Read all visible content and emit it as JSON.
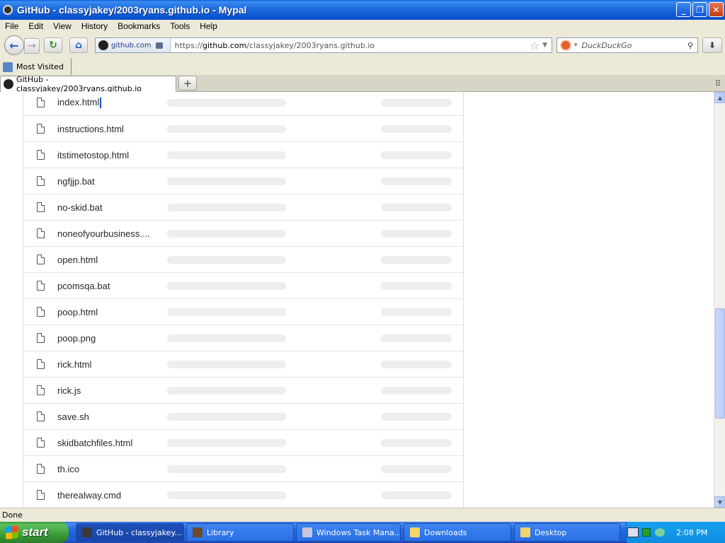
{
  "window": {
    "title": "GitHub - classyjakey/2003ryans.github.io - Mypal",
    "min_glyph": "_",
    "max_glyph": "❐",
    "close_glyph": "✕"
  },
  "menu": [
    "File",
    "Edit",
    "View",
    "History",
    "Bookmarks",
    "Tools",
    "Help"
  ],
  "nav": {
    "back_glyph": "←",
    "forward_glyph": "→",
    "reload_glyph": "↻",
    "home_glyph": "⌂",
    "site_identity": "github.com",
    "url_prefix": "https://",
    "url_domain": "github.com",
    "url_path": "/classyjakey/2003ryans.github.io",
    "star_glyph": "☆",
    "dropdown_glyph": "▼",
    "search_engine_dropdown": "▾",
    "search_placeholder": "DuckDuckGo",
    "search_glyph": "⚲",
    "download_glyph": "⬇"
  },
  "bookmarks": {
    "most_visited": "Most Visited"
  },
  "tabs": [
    {
      "label": "GitHub - classyjakey/2003ryans.github.io"
    }
  ],
  "tab_controls": {
    "new_tab_glyph": "+",
    "list_all_glyph": "⠿"
  },
  "files": [
    "index.html",
    "instructions.html",
    "itstimetostop.html",
    "ngfjjp.bat",
    "no-skid.bat",
    "noneofyourbusiness....",
    "open.html",
    "pcomsqa.bat",
    "poop.html",
    "poop.png",
    "rick.html",
    "rick.js",
    "save.sh",
    "skidbatchfiles.html",
    "th.ico",
    "therealway.cmd"
  ],
  "scrollbar": {
    "up_glyph": "▲",
    "down_glyph": "▼"
  },
  "status": {
    "text": "Done"
  },
  "taskbar": {
    "start_label": "start",
    "tasks": [
      {
        "label": "GitHub - classyjakey...",
        "icon_color": "#3a3a3a",
        "active": true
      },
      {
        "label": "Library",
        "icon_color": "#6a4a2a",
        "active": false
      },
      {
        "label": "Windows Task Mana...",
        "icon_color": "#c8c8d8",
        "active": false
      },
      {
        "label": "Downloads",
        "icon_color": "#f4d36a",
        "active": false
      },
      {
        "label": "Desktop",
        "icon_color": "#f4d36a",
        "active": false
      }
    ],
    "clock": "2:08 PM"
  }
}
